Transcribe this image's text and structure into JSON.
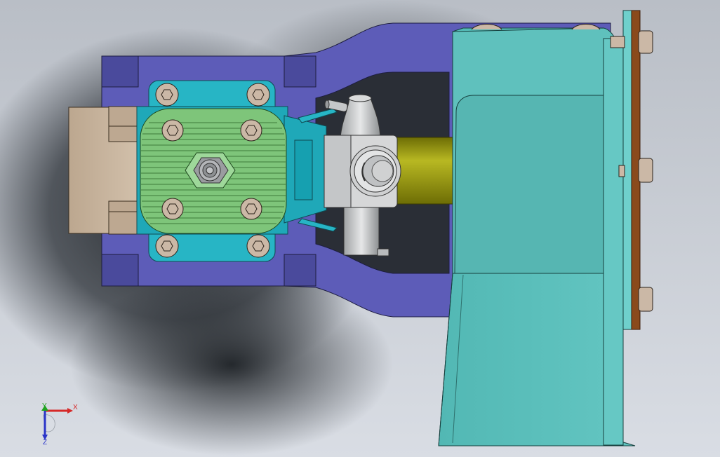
{
  "viewport": {
    "background_top": "#b9bec6",
    "background_bottom": "#d9dde4",
    "shadow_color": "#1c2024"
  },
  "colors": {
    "frame_blue": "#5d5cb8",
    "frame_blue_dark": "#4a4a9c",
    "teal": "#5fc1bd",
    "teal_dark": "#3aa7a3",
    "cyan_block": "#27b5c5",
    "head_green": "#7ec57a",
    "tan": "#c8b5a0",
    "bolt": "#cbb8a6",
    "carb_gray": "#c9cbcc",
    "shaft_olive": "#9a9a12",
    "flange_brown": "#8a4a1c"
  },
  "triad": {
    "x_label": "X",
    "y_label": "Y",
    "z_label": "Z",
    "x_color": "#d62828",
    "y_color": "#1fa31f",
    "z_color": "#2a34c8"
  }
}
